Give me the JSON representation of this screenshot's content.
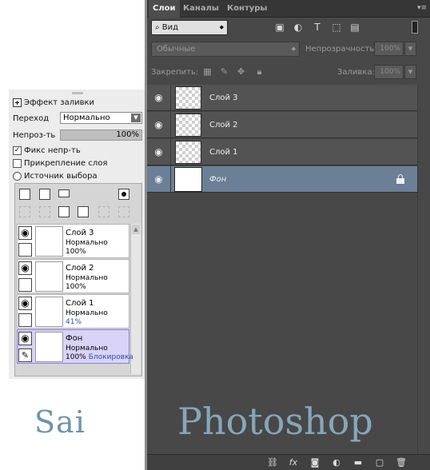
{
  "sai": {
    "fill_effect_label": "Эффект заливки",
    "blend_label": "Переход",
    "blend_value": "Нормально",
    "opacity_label": "Непроз-ть",
    "opacity_value": "100%",
    "preserve_opacity_label": "Фикс непр-ть",
    "preserve_opacity_checked": true,
    "clip_label": "Прикрепление слоя",
    "clip_checked": false,
    "selection_source_label": "Источник выбора",
    "layers": [
      {
        "name": "Слой 3",
        "mode": "Нормально",
        "opacity": "100%",
        "lock": "",
        "selected": false
      },
      {
        "name": "Слой 2",
        "mode": "Нормально",
        "opacity": "100%",
        "lock": "",
        "selected": false
      },
      {
        "name": "Слой 1",
        "mode": "Нормально",
        "opacity": "41%",
        "lock": "",
        "selected": false
      },
      {
        "name": "Фон",
        "mode": "Нормально",
        "opacity": "100%",
        "lock": "Блокировка",
        "selected": true
      }
    ],
    "logo_text": "Sai"
  },
  "photoshop": {
    "tabs": [
      "Слои",
      "Каналы",
      "Контуры"
    ],
    "active_tab": "Слои",
    "filter_kind": "Вид",
    "blend_mode": "Обычные",
    "opacity_label": "Непрозрачность:",
    "opacity_value": "100%",
    "lock_label": "Закрепить:",
    "fill_label": "Заливка:",
    "fill_value": "100%",
    "layers": [
      {
        "name": "Слой 3",
        "visible": true,
        "locked": false,
        "selected": false
      },
      {
        "name": "Слой 2",
        "visible": true,
        "locked": false,
        "selected": false
      },
      {
        "name": "Слой 1",
        "visible": true,
        "locked": false,
        "selected": false
      },
      {
        "name": "Фон",
        "visible": true,
        "locked": true,
        "selected": true
      }
    ],
    "bottom_fx": "fx",
    "logo_text": "Photoshop",
    "colors": {
      "panel_bg": "#484848",
      "selected_layer": "#6b7f97",
      "logo": "#86a6bb"
    }
  }
}
